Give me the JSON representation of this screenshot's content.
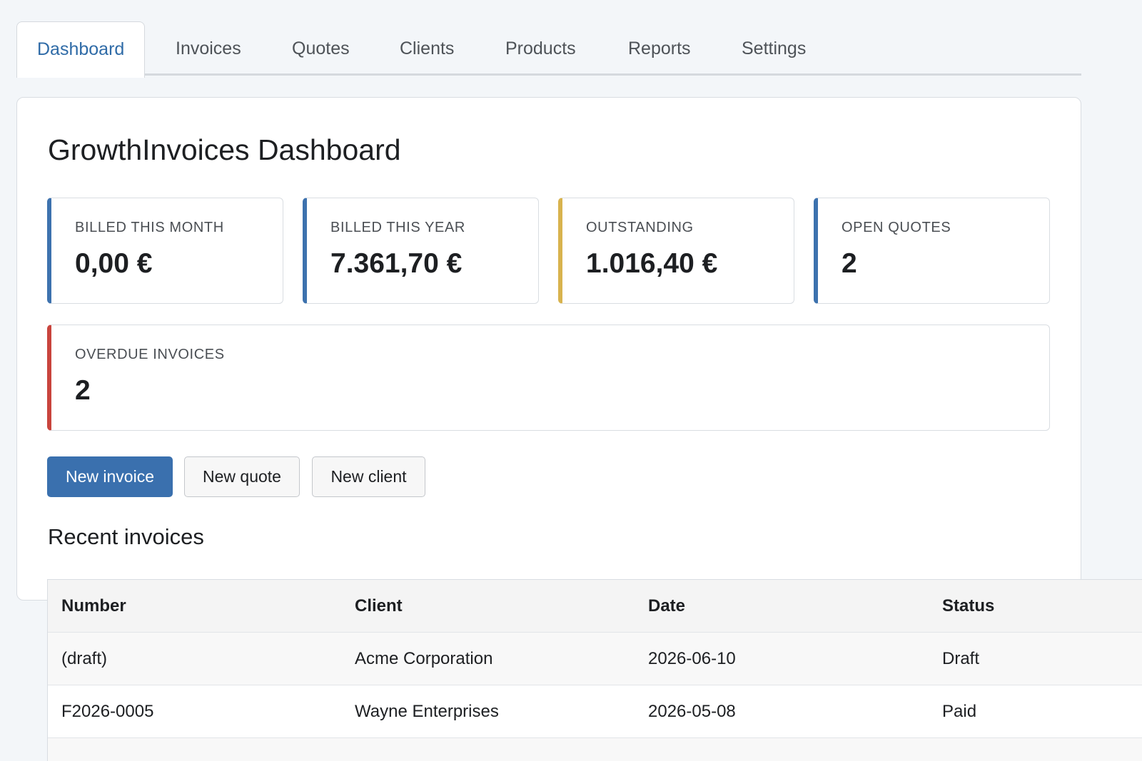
{
  "tabs": [
    {
      "label": "Dashboard",
      "active": true
    },
    {
      "label": "Invoices",
      "active": false
    },
    {
      "label": "Quotes",
      "active": false
    },
    {
      "label": "Clients",
      "active": false
    },
    {
      "label": "Products",
      "active": false
    },
    {
      "label": "Reports",
      "active": false
    },
    {
      "label": "Settings",
      "active": false
    }
  ],
  "page": {
    "title": "GrowthInvoices Dashboard"
  },
  "stats": {
    "billed_month": {
      "label": "BILLED THIS MONTH",
      "value": "0,00 €"
    },
    "billed_year": {
      "label": "BILLED THIS YEAR",
      "value": "7.361,70 €"
    },
    "outstanding": {
      "label": "OUTSTANDING",
      "value": "1.016,40 €"
    },
    "open_quotes": {
      "label": "OPEN QUOTES",
      "value": "2"
    },
    "overdue": {
      "label": "OVERDUE INVOICES",
      "value": "2"
    }
  },
  "actions": {
    "new_invoice": "New invoice",
    "new_quote": "New quote",
    "new_client": "New client"
  },
  "recent": {
    "title": "Recent invoices",
    "columns": [
      "Number",
      "Client",
      "Date",
      "Status"
    ],
    "rows": [
      [
        "(draft)",
        "Acme Corporation",
        "2026-06-10",
        "Draft"
      ],
      [
        "F2026-0005",
        "Wayne Enterprises",
        "2026-05-08",
        "Paid"
      ]
    ]
  },
  "colors": {
    "accent": "#3a70ae",
    "warning": "#d8b34e",
    "danger": "#c9443d"
  }
}
